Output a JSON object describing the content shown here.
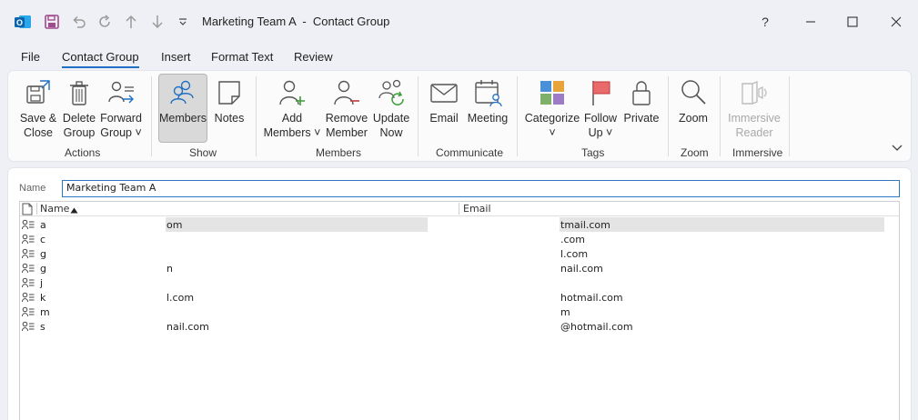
{
  "window": {
    "title": "Marketing Team A  -  Contact Group",
    "controls": [
      "?",
      "minimize",
      "maximize",
      "close"
    ]
  },
  "quick_access": [
    "outlook-app-icon",
    "save-icon",
    "undo-icon",
    "redo-icon",
    "up-arrow-icon",
    "down-arrow-icon",
    "customize-qat-icon"
  ],
  "menu": {
    "tabs": [
      "File",
      "Contact Group",
      "Insert",
      "Format Text",
      "Review"
    ],
    "active": "Contact Group"
  },
  "ribbon": {
    "groups": {
      "actions": "Actions",
      "show": "Show",
      "members": "Members",
      "communicate": "Communicate",
      "tags": "Tags",
      "zoom": "Zoom",
      "immersive": "Immersive"
    },
    "buttons": {
      "save_close": "Save &\nClose",
      "delete_group": "Delete\nGroup",
      "forward_group": "Forward\nGroup ˅",
      "members": "Members",
      "notes": "Notes",
      "add_members": "Add\nMembers ˅",
      "remove_member": "Remove\nMember",
      "update_now": "Update\nNow",
      "email": "Email",
      "meeting": "Meeting",
      "categorize": "Categorize\n˅",
      "follow_up": "Follow\nUp ˅",
      "private": "Private",
      "zoom": "Zoom",
      "immersive_reader": "Immersive\nReader"
    }
  },
  "form": {
    "name_label": "Name",
    "name_value": "Marketing Team A"
  },
  "list": {
    "columns": {
      "name": "Name",
      "email": "Email"
    },
    "sort": "name-ascending",
    "rows": [
      {
        "name": "a",
        "name_tail": "om",
        "email": "tmail.com",
        "selected": true
      },
      {
        "name": "c",
        "name_tail": "",
        "email": ".com",
        "selected": false
      },
      {
        "name": "g",
        "name_tail": "",
        "email": "l.com",
        "selected": false
      },
      {
        "name": "g",
        "name_tail": "n",
        "email": "nail.com",
        "selected": false
      },
      {
        "name": "j",
        "name_tail": "",
        "email": "",
        "selected": false
      },
      {
        "name": "k",
        "name_tail": "l.com",
        "email": "hotmail.com",
        "selected": false
      },
      {
        "name": "m",
        "name_tail": "",
        "email": "m",
        "selected": false
      },
      {
        "name": "s",
        "name_tail": "nail.com",
        "email": "@hotmail.com",
        "selected": false
      }
    ]
  }
}
